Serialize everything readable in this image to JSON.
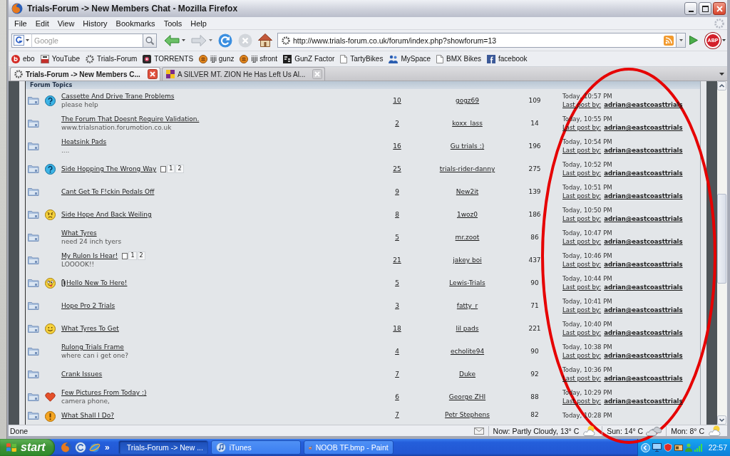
{
  "window": {
    "title": "Trials-Forum -> New Members Chat - Mozilla Firefox"
  },
  "menu": [
    "File",
    "Edit",
    "View",
    "History",
    "Bookmarks",
    "Tools",
    "Help"
  ],
  "toolbar": {
    "search_placeholder": "Google",
    "url": "http://www.trials-forum.co.uk/forum/index.php?showforum=13",
    "adblock": "ABP"
  },
  "bookmarks": [
    {
      "label": "ebo",
      "kind": "disc"
    },
    {
      "label": "YouTube",
      "kind": "tube"
    },
    {
      "label": "Trials-Forum",
      "kind": "gear"
    },
    {
      "label": "TORRENTS",
      "kind": "square"
    },
    {
      "label": "ijji gunz",
      "kind": "badge"
    },
    {
      "label": "ijji sfront",
      "kind": "badge"
    },
    {
      "label": "GunZ Factor",
      "kind": "tile"
    },
    {
      "label": "TartyBikes",
      "kind": "page"
    },
    {
      "label": "MySpace",
      "kind": "people"
    },
    {
      "label": "BMX Bikes",
      "kind": "page"
    },
    {
      "label": "facebook",
      "kind": "letter"
    }
  ],
  "tabs": [
    {
      "label": "Trials-Forum -> New Members C...",
      "selected": true,
      "kind": "gear"
    },
    {
      "label": "A SILVER MT. ZION He Has Left Us Al...",
      "selected": false,
      "kind": "album"
    }
  ],
  "forum": {
    "heading": "Forum Topics",
    "rows": [
      {
        "kind": "question",
        "attachment": false,
        "title": "Cassette And Drive Trane Problems",
        "subtitle": "please help",
        "replies": "10",
        "starter": "gogz69",
        "views": "109",
        "last_time": "Today, 10:57 PM",
        "last_label": "Last post by:",
        "last_member": "adrian@eastcoasttrials"
      },
      {
        "kind": "plain",
        "attachment": false,
        "title": "The Forum That Doesnt Require Validation.",
        "subtitle": "www.trialsnation.forumotion.co.uk",
        "replies": "2",
        "starter": "koxx_lass",
        "views": "14",
        "last_time": "Today, 10:55 PM",
        "last_label": "Last post by:",
        "last_member": "adrian@eastcoasttrials"
      },
      {
        "kind": "plain",
        "attachment": false,
        "title": "Heatsink Pads",
        "subtitle": "....",
        "replies": "16",
        "starter": "Gu trials :)",
        "views": "196",
        "last_time": "Today, 10:54 PM",
        "last_label": "Last post by:",
        "last_member": "adrian@eastcoasttrials"
      },
      {
        "kind": "question",
        "attachment": false,
        "title": "Side Hopping The Wrong Way",
        "pages": [
          "1",
          "2"
        ],
        "replies": "25",
        "starter": "trials-rider-danny",
        "views": "275",
        "last_time": "Today, 10:52 PM",
        "last_label": "Last post by:",
        "last_member": "adrian@eastcoasttrials"
      },
      {
        "kind": "plain",
        "attachment": false,
        "title": "Cant Get Te F!ckin Pedals Off",
        "replies": "9",
        "starter": "New2it",
        "views": "139",
        "last_time": "Today, 10:51 PM",
        "last_label": "Last post by:",
        "last_member": "adrian@eastcoasttrials"
      },
      {
        "kind": "angry",
        "attachment": false,
        "title": "Side Hope And Back Weiling",
        "replies": "8",
        "starter": "1woz0",
        "views": "186",
        "last_time": "Today, 10:50 PM",
        "last_label": "Last post by:",
        "last_member": "adrian@eastcoasttrials"
      },
      {
        "kind": "plain",
        "attachment": false,
        "title": "What Tyres",
        "subtitle": "need 24 inch tyers",
        "replies": "5",
        "starter": "mr.zoot",
        "views": "86",
        "last_time": "Today, 10:47 PM",
        "last_label": "Last post by:",
        "last_member": "adrian@eastcoasttrials"
      },
      {
        "kind": "plain",
        "attachment": false,
        "title": "My Rulon Is Hear!",
        "pages": [
          "1",
          "2"
        ],
        "subtitle": "LOOOOK!!",
        "replies": "21",
        "starter": "jakey boi",
        "views": "437",
        "last_time": "Today, 10:46 PM",
        "last_label": "Last post by:",
        "last_member": "adrian@eastcoasttrials"
      },
      {
        "kind": "silly",
        "attachment": true,
        "title": "Hello New To Here!",
        "replies": "5",
        "starter": "Lewis-Trials",
        "views": "90",
        "last_time": "Today, 10:44 PM",
        "last_label": "Last post by:",
        "last_member": "adrian@eastcoasttrials"
      },
      {
        "kind": "plain",
        "attachment": false,
        "title": "Hope Pro 2 Trials",
        "replies": "3",
        "starter": "fatty_r",
        "views": "71",
        "last_time": "Today, 10:41 PM",
        "last_label": "Last post by:",
        "last_member": "adrian@eastcoasttrials"
      },
      {
        "kind": "smile",
        "attachment": false,
        "title": "What Tyres To Get",
        "replies": "18",
        "starter": "lil pads",
        "views": "221",
        "last_time": "Today, 10:40 PM",
        "last_label": "Last post by:",
        "last_member": "adrian@eastcoasttrials"
      },
      {
        "kind": "plain",
        "attachment": false,
        "title": "Rulong Trials Frame",
        "subtitle": "where can i get one?",
        "replies": "4",
        "starter": "echolite94",
        "views": "90",
        "last_time": "Today, 10:38 PM",
        "last_label": "Last post by:",
        "last_member": "adrian@eastcoasttrials"
      },
      {
        "kind": "plain",
        "attachment": false,
        "title": "Crank Issues",
        "replies": "7",
        "starter": "Duke",
        "views": "92",
        "last_time": "Today, 10:36 PM",
        "last_label": "Last post by:",
        "last_member": "adrian@eastcoasttrials"
      },
      {
        "kind": "heart",
        "attachment": false,
        "title": "Few Pictures From Today :)",
        "subtitle": "camera phone,",
        "replies": "6",
        "starter": "George ZHI",
        "views": "88",
        "last_time": "Today, 10:29 PM",
        "last_label": "Last post by:",
        "last_member": "adrian@eastcoasttrials"
      },
      {
        "kind": "warning",
        "attachment": false,
        "title": "What Shall I Do?",
        "replies": "7",
        "starter": "Petr Stephens",
        "views": "82",
        "last_time": "Today, 10:28 PM"
      }
    ]
  },
  "status_bar": {
    "text": "Done",
    "forecast": [
      {
        "label": "Now: Partly Cloudy, 13° C",
        "kind": "partly"
      },
      {
        "label": "Sun: 14° C",
        "kind": "cloudy"
      },
      {
        "label": "Mon: 8° C",
        "kind": "partly"
      }
    ]
  },
  "taskbar": {
    "start": "start",
    "more": "»",
    "tasks": [
      {
        "label": "Trials-Forum -> New ...",
        "selected": true,
        "kind": "browser"
      },
      {
        "label": "iTunes",
        "selected": false,
        "kind": "music"
      },
      {
        "label": "NOOB TF.bmp - Paint",
        "selected": false,
        "kind": "paint"
      }
    ],
    "clock": "22:57"
  }
}
